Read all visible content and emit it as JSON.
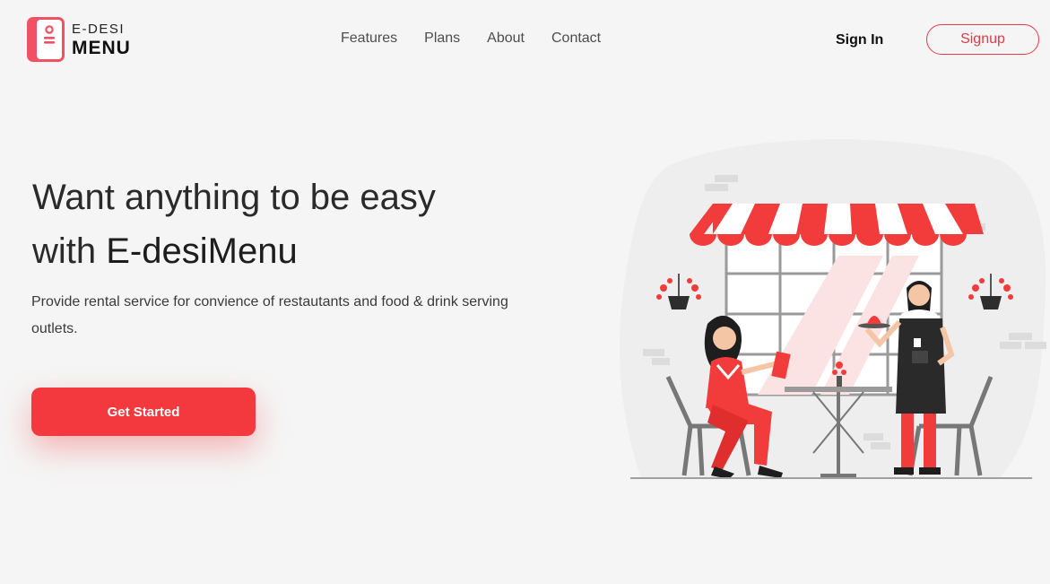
{
  "header": {
    "logo_top": "E-DESI",
    "logo_bottom": "MENU",
    "nav": [
      "Features",
      "Plans",
      "About",
      "Contact"
    ],
    "signin_label": "Sign In",
    "signup_label": "Signup"
  },
  "hero": {
    "title_line1": "Want anything to be easy",
    "title_with": "with ",
    "title_brand": "E-desiMenu",
    "description": "Provide rental service for convience of restautants and food & drink serving outlets.",
    "cta_label": "Get Started"
  },
  "colors": {
    "accent": "#f3393d",
    "signup_border": "#e23a4a",
    "background": "#f5f5f5"
  },
  "icons": {
    "logo": "menu-card-icon",
    "illustration": "restaurant-cafe-illustration"
  }
}
